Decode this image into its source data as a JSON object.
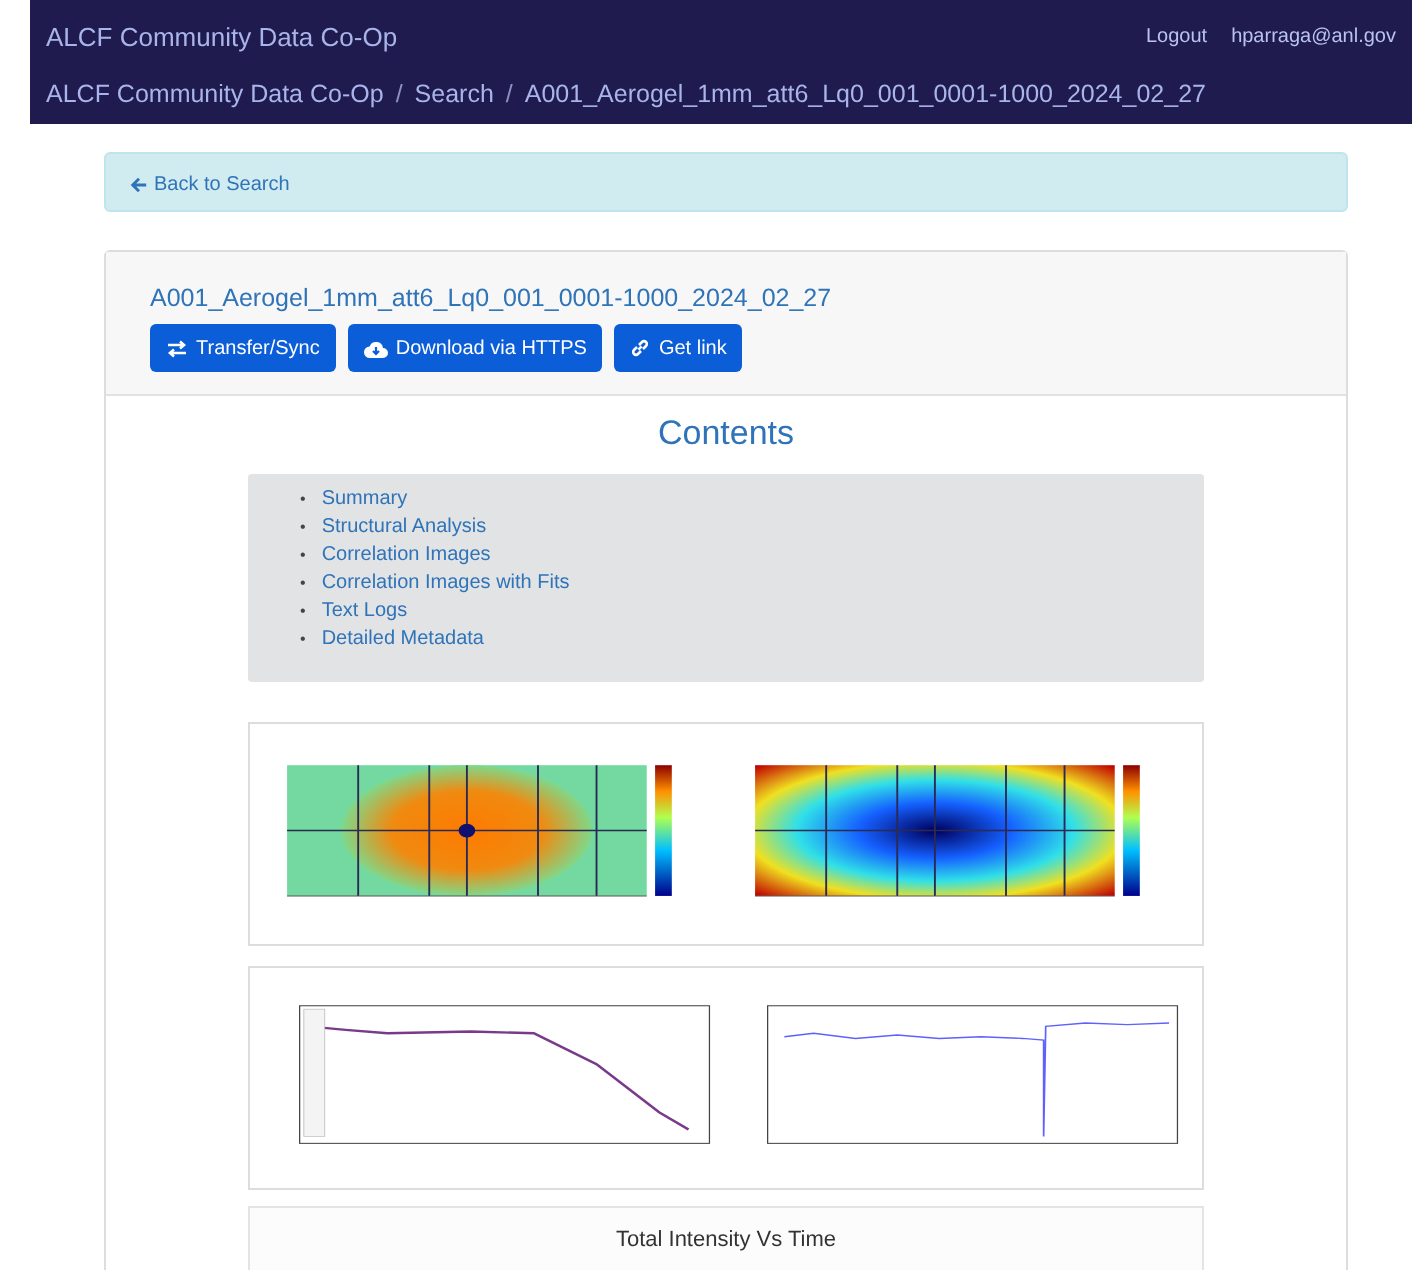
{
  "navbar": {
    "brand": "ALCF Community Data Co-Op",
    "links": [
      "Logout",
      "hparraga@anl.gov"
    ]
  },
  "breadcrumb": {
    "separator": "/",
    "items": [
      "ALCF Community Data Co-Op",
      "Search",
      "A001_Aerogel_1mm_att6_Lq0_001_0001-1000_2024_02_27"
    ]
  },
  "back_link": "Back to Search",
  "dataset": {
    "title": "A001_Aerogel_1mm_att6_Lq0_001_0001-1000_2024_02_27",
    "buttons": [
      {
        "label": "Transfer/Sync",
        "kind": "transfer"
      },
      {
        "label": "Download via HTTPS",
        "kind": "download"
      },
      {
        "label": "Get link",
        "kind": "link"
      }
    ]
  },
  "contents": {
    "heading": "Contents",
    "marker": "•",
    "items": [
      "Summary",
      "Structural Analysis",
      "Correlation Images",
      "Correlation Images with Fits",
      "Text Logs",
      "Detailed Metadata"
    ]
  },
  "section_heading": "Total Intensity Vs Time"
}
